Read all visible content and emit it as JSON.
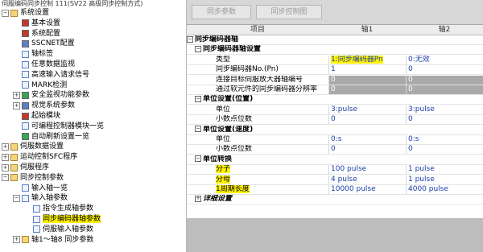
{
  "tree": {
    "title": "伺服编码同步控制 111(SV22 高级同步控制方式)",
    "items": [
      {
        "label": "系统设置",
        "expander": "−",
        "icon": "folder"
      },
      {
        "label": "基本设置",
        "icon": "red"
      },
      {
        "label": "系统配置",
        "icon": "red"
      },
      {
        "label": "SSCNET配置",
        "icon": "blue"
      },
      {
        "label": "轴标签",
        "icon": "doc"
      },
      {
        "label": "任意数据监视",
        "icon": "doc"
      },
      {
        "label": "高速输入请求信号",
        "icon": "doc"
      },
      {
        "label": "MARK检测",
        "icon": "doc"
      },
      {
        "label": "安全监视功能参数",
        "expander": "+",
        "icon": "green"
      },
      {
        "label": "视觉系统参数",
        "expander": "+",
        "icon": "blue"
      },
      {
        "label": "起始模块",
        "icon": "red"
      },
      {
        "label": "可编程控制器模块一览",
        "icon": "doc"
      },
      {
        "label": "自动刷新设置一览",
        "icon": "green"
      },
      {
        "label": "伺服数据设置",
        "expander": "+",
        "icon": "folder"
      },
      {
        "label": "运动控制SFC程序",
        "expander": "+",
        "icon": "folder"
      },
      {
        "label": "伺服程序",
        "expander": "+",
        "icon": "folder"
      },
      {
        "label": "同步控制参数",
        "expander": "−",
        "icon": "folder"
      },
      {
        "label": "输入轴一览",
        "icon": "doc"
      },
      {
        "label": "输入轴参数",
        "expander": "−",
        "icon": "doc"
      },
      {
        "label": "指令生成轴参数",
        "icon": "doc"
      },
      {
        "label": "同步编码器轴参数",
        "icon": "doc",
        "highlight": true
      },
      {
        "label": "伺服输入轴参数",
        "icon": "doc"
      },
      {
        "label": "轴1～轴8 同步参数",
        "expander": "+",
        "icon": "folder"
      }
    ]
  },
  "toolbar": {
    "btn_sync_param": "同步参数",
    "btn_sync_diagram": "同步控制图"
  },
  "grid": {
    "headers": {
      "item": "项目",
      "axis1": "轴1",
      "axis2": "轴2"
    },
    "rows": [
      {
        "label": "同步编码器轴",
        "a1": "",
        "a2": "",
        "kind": "section"
      },
      {
        "label": "同步编码器轴设置",
        "a1": "",
        "a2": "",
        "kind": "subsection"
      },
      {
        "label": "类型",
        "a1": "1:同步编码器Pn",
        "a2": "0:无效",
        "kind": "item"
      },
      {
        "label": "同步编码器No.(Pn)",
        "a1": "1",
        "a2": "0",
        "kind": "item"
      },
      {
        "label": "连接目标伺服放大器轴编号",
        "a1": "0",
        "a2": "0",
        "kind": "item",
        "gray": true
      },
      {
        "label": "通过软元件的同步编码器分辨率",
        "a1": "0",
        "a2": "0",
        "kind": "item",
        "gray": true
      },
      {
        "label": "单位设置(位置)",
        "a1": "",
        "a2": "",
        "kind": "subsection"
      },
      {
        "label": "单位",
        "a1": "3:pulse",
        "a2": "3:pulse",
        "kind": "item"
      },
      {
        "label": "小数点位数",
        "a1": "0",
        "a2": "0",
        "kind": "item"
      },
      {
        "label": "单位设置(速度)",
        "a1": "",
        "a2": "",
        "kind": "subsection"
      },
      {
        "label": "单位",
        "a1": "0:s",
        "a2": "0:s",
        "kind": "item"
      },
      {
        "label": "小数点位数",
        "a1": "0",
        "a2": "0",
        "kind": "item"
      },
      {
        "label": "单位转换",
        "a1": "",
        "a2": "",
        "kind": "subsection"
      },
      {
        "label": "分子",
        "a1": "100 pulse",
        "a2": "1 pulse",
        "kind": "item",
        "highlight": true
      },
      {
        "label": "分母",
        "a1": "4 pulse",
        "a2": "1 pulse",
        "kind": "item",
        "highlight": true
      },
      {
        "label": "1周期长度",
        "a1": "10000 pulse",
        "a2": "4000 pulse",
        "kind": "item",
        "highlight": true
      },
      {
        "label": "详细设置",
        "a1": "",
        "a2": "",
        "kind": "collapsed"
      }
    ]
  },
  "colors": {
    "highlight": "#fff200",
    "value_text": "#1a3fa8",
    "disabled_cell": "#a9a9a9",
    "panel_bg": "#bdbdbd"
  }
}
